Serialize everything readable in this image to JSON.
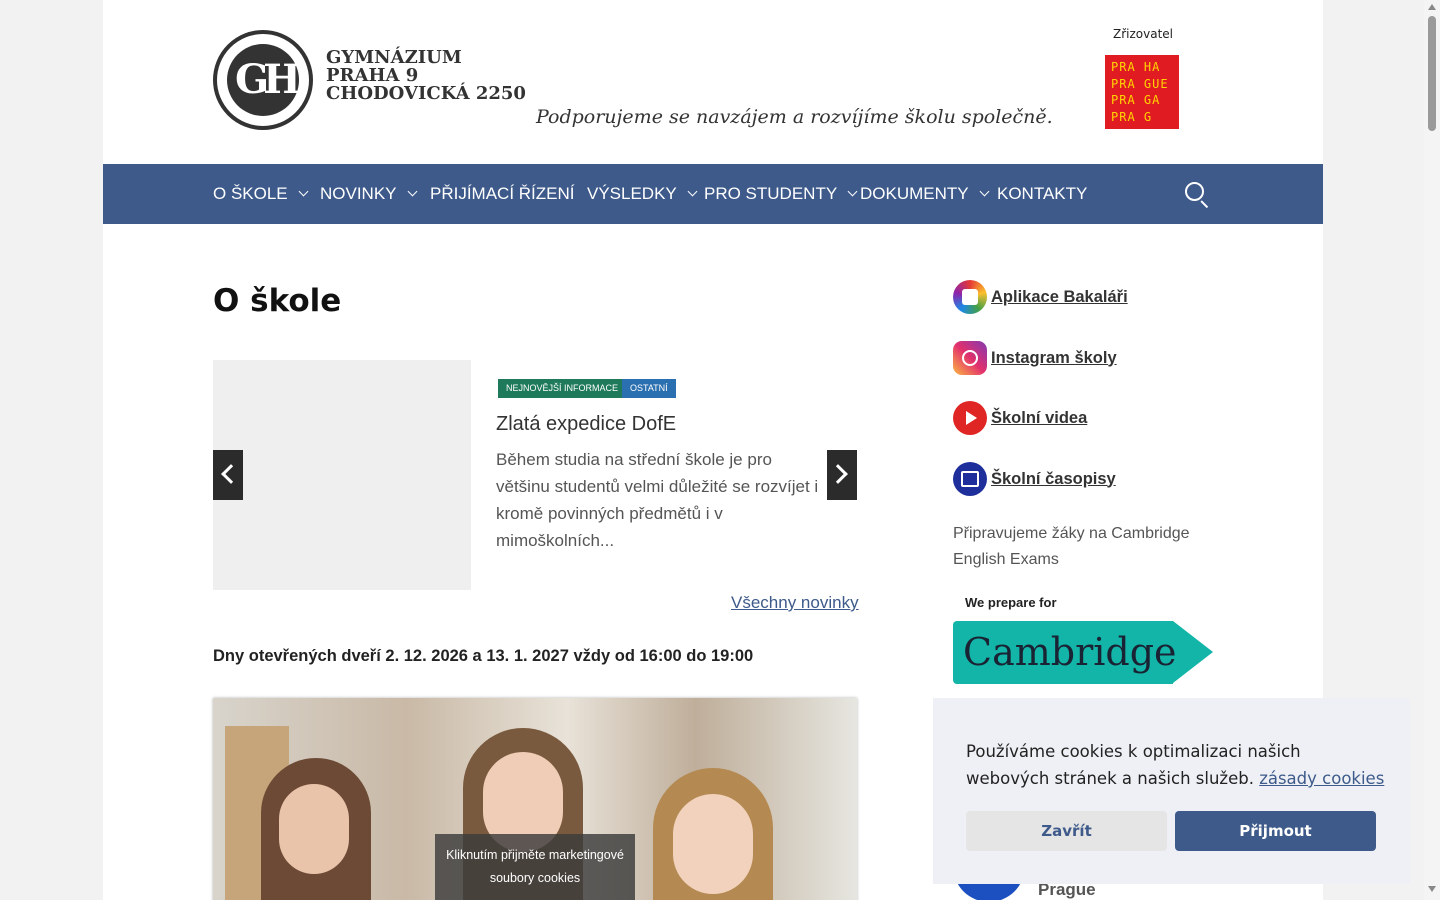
{
  "header": {
    "school_name_lines": [
      "GYMNÁZIUM",
      "PRAHA 9",
      "CHODOVICKÁ 2250"
    ],
    "logo_letters": "GH",
    "motto": "Podporujeme se navzájem  a rozvíjíme školu společně.",
    "zrizovatel_label": "Zřizovatel",
    "praha_logo_lines": [
      "PRA HA",
      "PRA GUE",
      "PRA GA",
      "PRA G"
    ]
  },
  "nav": {
    "items": [
      {
        "label": "O ŠKOLE",
        "dropdown": true
      },
      {
        "label": "NOVINKY",
        "dropdown": true
      },
      {
        "label": "PŘIJÍMACÍ ŘÍZENÍ",
        "dropdown": false
      },
      {
        "label": "VÝSLEDKY",
        "dropdown": true
      },
      {
        "label": "PRO STUDENTY",
        "dropdown": true
      },
      {
        "label": "DOKUMENTY",
        "dropdown": true
      },
      {
        "label": "KONTAKTY",
        "dropdown": false
      }
    ],
    "search_icon": "search-icon"
  },
  "main": {
    "title": "O škole",
    "slider": {
      "tags": [
        "NEJNOVĚJŠÍ INFORMACE",
        "OSTATNÍ"
      ],
      "post_title": "Zlatá expedice DofE",
      "excerpt": "Během studia na střední škole je pro většinu studentů velmi důležité se rozvíjet i kromě povinných předmětů i v mimoškolních...",
      "all_news": "Všechny novinky"
    },
    "open_days": "Dny otevřených dveří 2. 12. 2026 a 13. 1. 2027 vždy od 16:00 do 19:00",
    "photo_overlay": "Kliknutím přijměte marketingové soubory cookies"
  },
  "sidebar": {
    "links": [
      {
        "label": "Aplikace Bakaláři",
        "icon": "bakalari-icon"
      },
      {
        "label": "Instagram školy",
        "icon": "instagram-icon"
      },
      {
        "label": "Školní videa",
        "icon": "youtube-icon"
      },
      {
        "label": "Školní časopisy",
        "icon": "magazine-icon"
      }
    ],
    "cambridge_text": "Připravujeme žáky na Cambridge English Exams",
    "cambridge_badge_top": "We prepare for",
    "cambridge_badge_main": "Cambridge",
    "partner_text": "Prague"
  },
  "cookie": {
    "message": "Používáme cookies k optimalizaci našich webových stránek a našich služeb.",
    "policy_link": "zásady cookies",
    "close_label": "Zavřít",
    "accept_label": "Přijmout"
  },
  "colors": {
    "nav_bg": "#3d5a8a",
    "tag_news": "#1e7a5a",
    "tag_other": "#2a6fb0",
    "cambridge": "#12b5a8",
    "praha_red": "#e01b22"
  }
}
